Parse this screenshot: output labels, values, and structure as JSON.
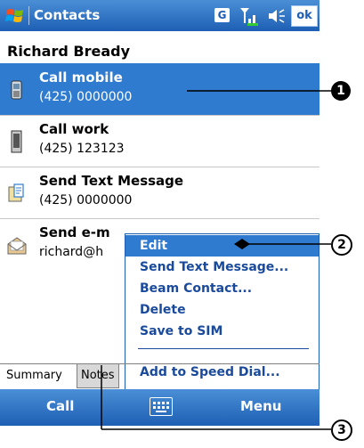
{
  "title_bar": {
    "title": "Contacts",
    "data_indicator": "G",
    "ok_label": "ok",
    "icons": [
      "windows-start-icon",
      "signal-icon",
      "volume-icon"
    ]
  },
  "contact": {
    "name": "Richard Bready"
  },
  "items": [
    {
      "label": "Call mobile",
      "sub": "(425) 0000000",
      "icon": "mobile-phone-icon",
      "selected": true
    },
    {
      "label": "Call work",
      "sub": "(425) 123123",
      "icon": "work-phone-icon",
      "selected": false
    },
    {
      "label": "Send Text Message",
      "sub": "(425) 0000000",
      "icon": "text-message-icon",
      "selected": false
    },
    {
      "label": "Send e-mail",
      "sub": "richard@h",
      "visible_label": "Send e-m",
      "visible_sub": "richard@h",
      "icon": "email-icon",
      "selected": false
    }
  ],
  "context_menu": {
    "items": [
      "Edit",
      "Send Text Message...",
      "Beam Contact...",
      "Delete",
      "Save to SIM",
      "Add to Speed Dial..."
    ],
    "highlighted": "Edit"
  },
  "tabs": [
    "Summary",
    "Notes"
  ],
  "bottom_bar": {
    "left": "Call",
    "right": "Menu",
    "center_icon": "keyboard-icon"
  },
  "callouts": [
    "1",
    "2",
    "3"
  ],
  "colors": {
    "accent": "#2e7bd0",
    "menu_text": "#1a4a9c"
  }
}
